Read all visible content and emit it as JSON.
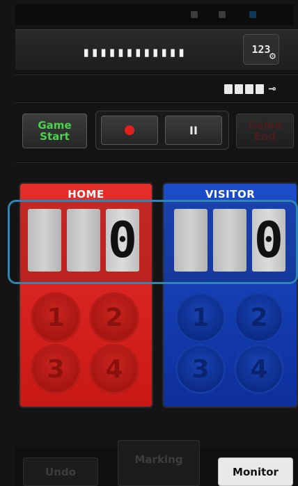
{
  "header": {
    "counter_text": "▮▮▮▮▮▮▮▮▮▮▮▮",
    "settings_label": "123",
    "settings_icon": "gear-icon",
    "battery_icon": "battery-plug-icon"
  },
  "controls": {
    "game_start": "Game\nStart",
    "record_icon": "record-icon",
    "pause_label": "II",
    "game_end": "Game\nEnd"
  },
  "teams": {
    "home": {
      "label": "HOME",
      "score": "0",
      "color": "#e52e2a"
    },
    "visitor": {
      "label": "VISITOR",
      "score": "0",
      "color": "#1c4cc9"
    }
  },
  "point_buttons": [
    "1",
    "2",
    "3",
    "4"
  ],
  "bottom": {
    "undo": "Undo",
    "marking": "Marking",
    "monitor": "Monitor"
  },
  "colors": {
    "accent_frame": "#2f86b3",
    "start_green": "#49d24b",
    "record_red": "#e0201b"
  }
}
